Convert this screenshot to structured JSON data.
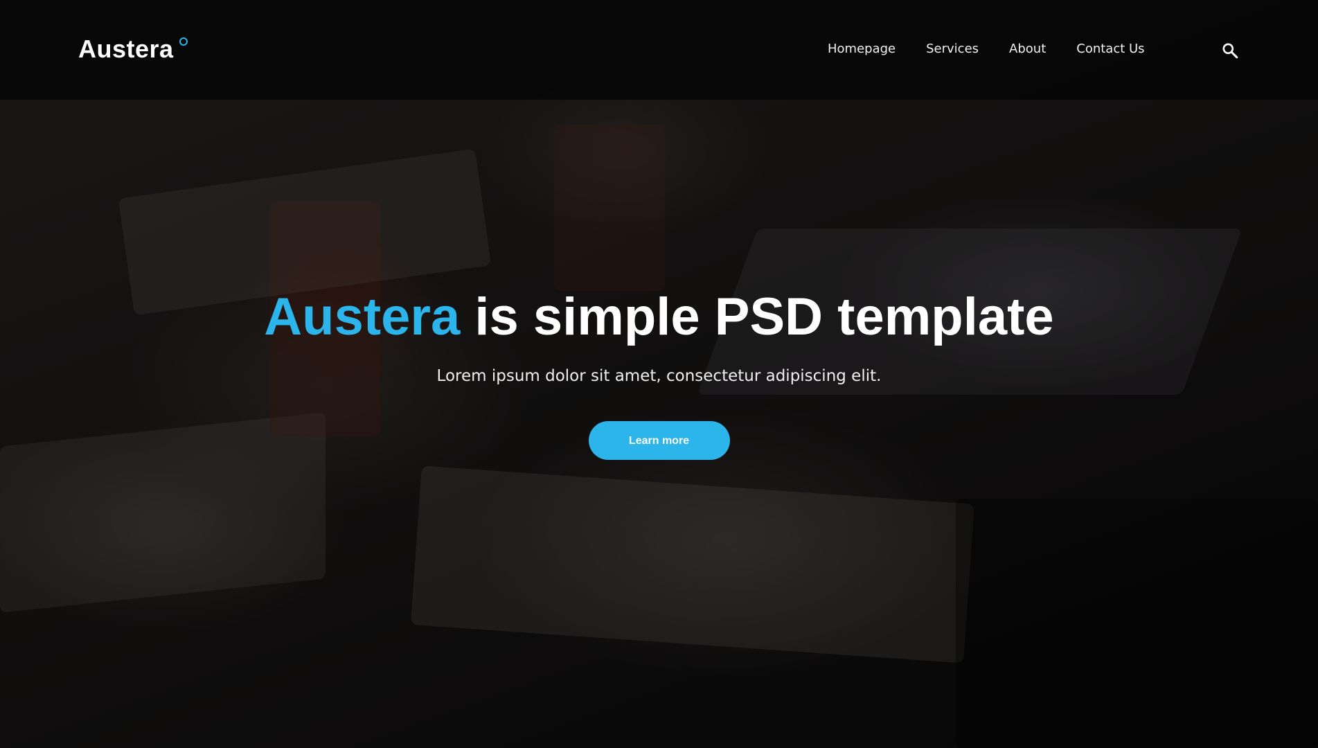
{
  "header": {
    "logo_text": "Austera",
    "nav": [
      {
        "label": "Homepage"
      },
      {
        "label": "Services"
      },
      {
        "label": "About"
      },
      {
        "label": "Contact Us"
      }
    ],
    "search_icon": "search-icon"
  },
  "hero": {
    "title_accent": "Austera",
    "title_rest": " is simple PSD template",
    "subtitle": "Lorem ipsum dolor sit amet, consectetur adipiscing elit.",
    "cta_label": "Learn more"
  },
  "colors": {
    "accent": "#2bb5ea",
    "header_bg": "#050506",
    "text": "#ffffff"
  }
}
